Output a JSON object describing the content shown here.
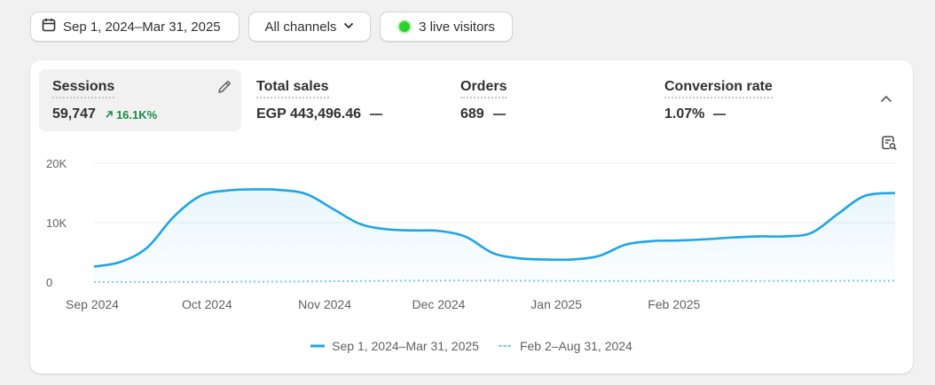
{
  "toolbar": {
    "date_range": "Sep 1, 2024–Mar 31, 2025",
    "channels": "All channels",
    "live_visitors": "3 live visitors"
  },
  "metrics": [
    {
      "label": "Sessions",
      "value": "59,747",
      "trend": "16.1K%"
    },
    {
      "label": "Total sales",
      "value": "EGP 443,496.46"
    },
    {
      "label": "Orders",
      "value": "689"
    },
    {
      "label": "Conversion rate",
      "value": "1.07%"
    }
  ],
  "colors": {
    "accent": "#1fa5e6",
    "trend_up": "#1d8a4a",
    "live": "#2cd12c"
  },
  "icons": [
    "calendar-icon",
    "chevron-down-icon",
    "pencil-icon",
    "trend-up-icon",
    "chevron-up-icon",
    "report-search-icon"
  ],
  "chart_data": {
    "type": "area",
    "ylim": [
      0,
      20000
    ],
    "yticks": [
      0,
      10000,
      20000
    ],
    "ytick_labels": [
      "0",
      "10K",
      "20K"
    ],
    "xtick_labels": [
      "Sep 2024",
      "Oct 2024",
      "Nov 2024",
      "Dec 2024",
      "Jan 2025",
      "Feb 2025"
    ],
    "grid": true,
    "legend_position": "bottom-center",
    "series": [
      {
        "name": "Sep 1, 2024–Mar 31, 2025",
        "style": "solid",
        "x": [
          "2024-09-01",
          "2024-09-08",
          "2024-09-15",
          "2024-09-22",
          "2024-09-29",
          "2024-10-06",
          "2024-10-13",
          "2024-10-20",
          "2024-10-27",
          "2024-11-03",
          "2024-11-10",
          "2024-11-17",
          "2024-11-24",
          "2024-12-01",
          "2024-12-08",
          "2024-12-15",
          "2024-12-22",
          "2024-12-29",
          "2025-01-05",
          "2025-01-12",
          "2025-01-19",
          "2025-01-26",
          "2025-02-02",
          "2025-02-09",
          "2025-02-16",
          "2025-02-23",
          "2025-03-02",
          "2025-03-09",
          "2025-03-16",
          "2025-03-23",
          "2025-03-31"
        ],
        "values": [
          2600,
          3400,
          5800,
          11000,
          14500,
          15400,
          15600,
          15500,
          14800,
          12300,
          9800,
          8900,
          8700,
          8600,
          7600,
          4900,
          4000,
          3800,
          3800,
          4400,
          6300,
          6900,
          7000,
          7200,
          7500,
          7700,
          7700,
          8300,
          11500,
          14500,
          15000
        ]
      },
      {
        "name": "Feb 2–Aug 31, 2024",
        "style": "dotted",
        "x": [
          "2024-09-01",
          "2024-10-15",
          "2024-12-01",
          "2025-01-15",
          "2025-03-01",
          "2025-03-31"
        ],
        "values": [
          20,
          60,
          250,
          180,
          200,
          230
        ]
      }
    ]
  }
}
